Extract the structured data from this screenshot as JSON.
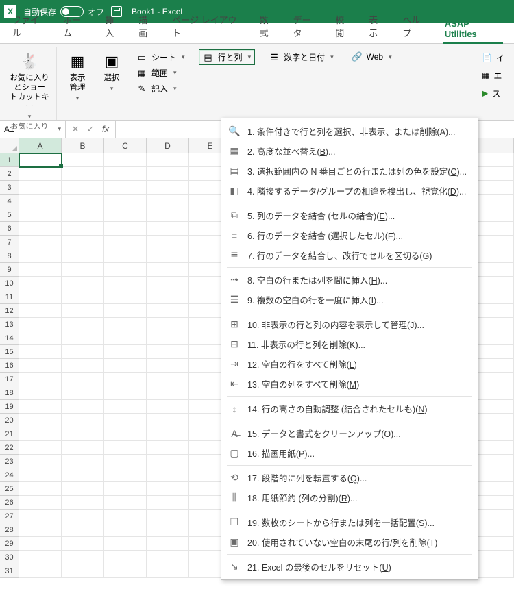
{
  "titlebar": {
    "autosave_label": "自動保存",
    "autosave_state": "オフ",
    "title": "Book1  -  Excel"
  },
  "tabs": {
    "file": "ファイル",
    "home": "ホーム",
    "insert": "挿入",
    "draw": "描画",
    "page_layout": "ページ レイアウト",
    "formulas": "数式",
    "data": "データ",
    "review": "校閲",
    "view": "表示",
    "help": "ヘルプ",
    "asap": "ASAP Utilities"
  },
  "ribbon": {
    "favorites": {
      "btn": "お気に入りとショー\nトカットキー",
      "caption": "お気に入り"
    },
    "vision": {
      "btn": "表示\n管理"
    },
    "select": {
      "btn": "選択"
    },
    "sheet_group": {
      "sheets": "シート",
      "range": "範囲",
      "notes": "記入"
    },
    "rows_cols": "行と列",
    "numbers_date": "数字と日付",
    "web": "Web",
    "right": {
      "import": "イ",
      "export": "エ",
      "start": "ス"
    }
  },
  "fx": {
    "namebox": "A1"
  },
  "columns": [
    "A",
    "B",
    "C",
    "D",
    "E"
  ],
  "row_count": 31,
  "active_cell": {
    "row": 1,
    "col": "A"
  },
  "menu": {
    "items": [
      {
        "n": "1.",
        "t_pre": "条件付きで行と列を選択、非表示、または削除(",
        "u": "A",
        "t_post": ")...",
        "ic": "🔍"
      },
      {
        "n": "2.",
        "t_pre": "高度な並べ替え(",
        "u": "B",
        "t_post": ")...",
        "ic": "▦"
      },
      {
        "n": "3.",
        "t_pre": "選択範囲内の N 番目ごとの行または列の色を設定(",
        "u": "C",
        "t_post": ")...",
        "ic": "▤"
      },
      {
        "n": "4.",
        "t_pre": "隣接するデータ/グループの相違を検出し、視覚化(",
        "u": "D",
        "t_post": ")...",
        "ic": "◧"
      },
      {
        "sep": true
      },
      {
        "n": "5.",
        "t_pre": "列のデータを結合 (セルの結合)(",
        "u": "E",
        "t_post": ")...",
        "ic": "⧉"
      },
      {
        "n": "6.",
        "t_pre": "行のデータを結合 (選択したセル)(",
        "u": "F",
        "t_post": ")...",
        "ic": "≡"
      },
      {
        "n": "7.",
        "t_pre": "行のデータを結合し、改行でセルを区切る(",
        "u": "G",
        "t_post": ")",
        "ic": "≣"
      },
      {
        "sep": true
      },
      {
        "n": "8.",
        "t_pre": "空白の行または列を間に挿入(",
        "u": "H",
        "t_post": ")...",
        "ic": "⇢"
      },
      {
        "n": "9.",
        "t_pre": "複数の空白の行を一度に挿入(",
        "u": "I",
        "t_post": ")...",
        "ic": "☰"
      },
      {
        "sep": true
      },
      {
        "n": "10.",
        "t_pre": "非表示の行と列の内容を表示して管理(",
        "u": "J",
        "t_post": ")...",
        "ic": "⊞"
      },
      {
        "n": "11.",
        "t_pre": "非表示の行と列を削除(",
        "u": "K",
        "t_post": ")...",
        "ic": "⊟"
      },
      {
        "n": "12.",
        "t_pre": "空白の行をすべて削除(",
        "u": "L",
        "t_post": ")",
        "ic": "⇥"
      },
      {
        "n": "13.",
        "t_pre": "空白の列をすべて削除(",
        "u": "M",
        "t_post": ")",
        "ic": "⇤"
      },
      {
        "sep": true
      },
      {
        "n": "14.",
        "t_pre": "行の高さの自動調整 (結合されたセルも)(",
        "u": "N",
        "t_post": ")",
        "ic": "↕"
      },
      {
        "sep": true
      },
      {
        "n": "15.",
        "t_pre": "データと書式をクリーンアップ(",
        "u": "O",
        "t_post": ")...",
        "ic": "A̶"
      },
      {
        "n": "16.",
        "t_pre": "描画用紙(",
        "u": "P",
        "t_post": ")...",
        "ic": "▢"
      },
      {
        "sep": true
      },
      {
        "n": "17.",
        "t_pre": "段階的に列を転置する(",
        "u": "Q",
        "t_post": ")...",
        "ic": "⟲"
      },
      {
        "n": "18.",
        "t_pre": "用紙節約 (列の分割)(",
        "u": "R",
        "t_post": ")...",
        "ic": "⫼"
      },
      {
        "sep": true
      },
      {
        "n": "19.",
        "t_pre": "数枚のシートから行または列を一括配置(",
        "u": "S",
        "t_post": ")...",
        "ic": "❐"
      },
      {
        "n": "20.",
        "t_pre": "使用されていない空白の末尾の行/列を削除(",
        "u": "T",
        "t_post": ")",
        "ic": "▣"
      },
      {
        "sep": true
      },
      {
        "n": "21.",
        "t_pre": "Excel の最後のセルをリセット(",
        "u": "U",
        "t_post": ")",
        "ic": "↘"
      }
    ]
  }
}
